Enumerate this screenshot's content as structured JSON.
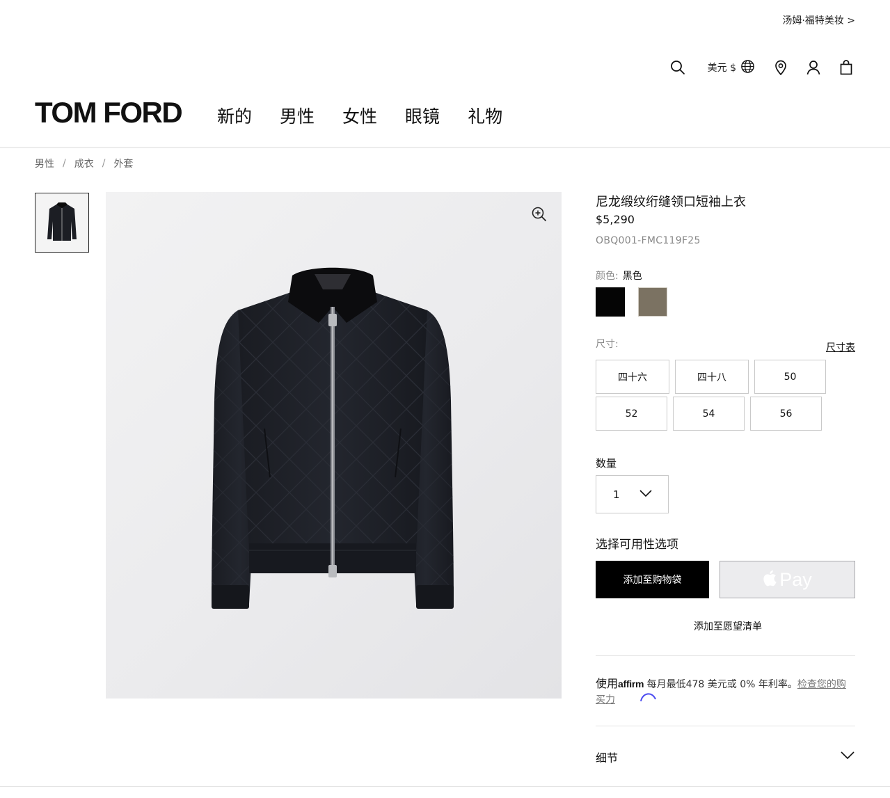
{
  "header": {
    "beauty_link": "汤姆·福特美妆 >",
    "currency": "美元 $",
    "logo": "TOM FORD",
    "nav": [
      "新的",
      "男性",
      "女性",
      "眼镜",
      "礼物"
    ],
    "icons": [
      "search-icon",
      "globe-icon",
      "location-pin-icon",
      "account-icon",
      "shopping-bag-icon"
    ]
  },
  "breadcrumb": [
    "男性",
    "成衣",
    "外套"
  ],
  "breadcrumb_separator": "/",
  "product": {
    "title": "尼龙缎纹绗缝领口短袖上衣",
    "price": "$5,290",
    "sku": "OBQ001-FMC119F25",
    "color_label": "颜色:",
    "color_value": "黑色",
    "swatches": [
      {
        "name": "black",
        "color": "#050505"
      },
      {
        "name": "olive",
        "color": "#7b7262"
      }
    ],
    "size_label": "尺寸:",
    "size_guide": "尺寸表",
    "sizes": [
      "四十六",
      "四十八",
      "50",
      "52",
      "54",
      "56"
    ],
    "quantity_label": "数量",
    "quantity_value": "1",
    "availability_label": "选择可用性选项",
    "add_to_cart": "添加至购物袋",
    "apple_pay": "Pay",
    "wishlist": "添加至愿望清单"
  },
  "affirm": {
    "prefix": "使用",
    "brand": "affirm",
    "text": " 每月最低478 美元或 0% 年利率。",
    "link": "检查您的购买力"
  },
  "details": {
    "label": "细节"
  },
  "colors": {
    "primary": "#000000",
    "border": "#c9c9c9",
    "muted": "#888888"
  }
}
